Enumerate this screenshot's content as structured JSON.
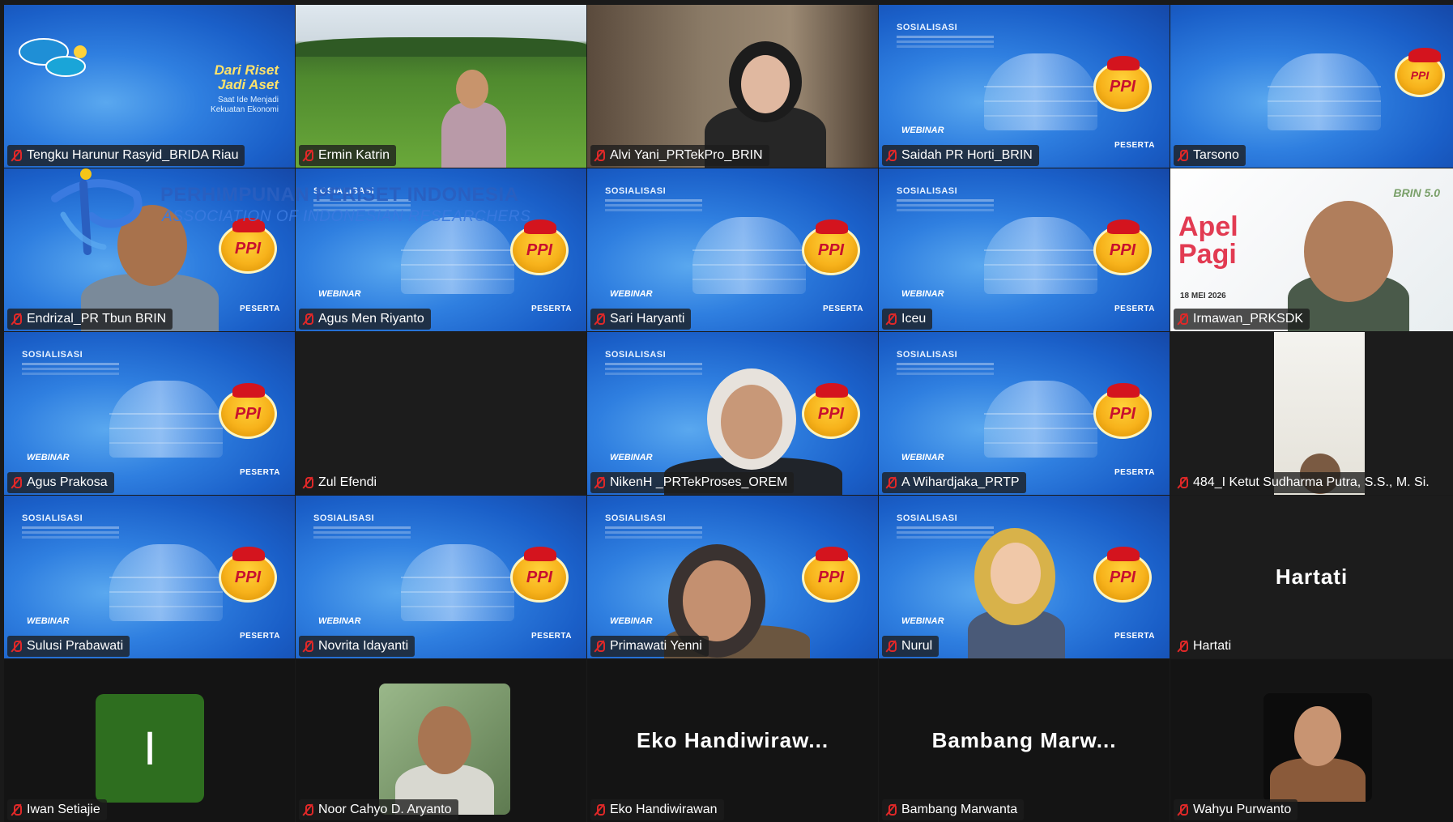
{
  "watermark": {
    "title": "PERHIMPUNAN PERISET INDONESIA",
    "subtitle": "ASSOCIATION OF INDONESIAN RESEARCHERS"
  },
  "slide": {
    "heading": "SOSIALISASI",
    "webinar": "WEBINAR",
    "peserta": "PESERTA",
    "badge": "PPI"
  },
  "campus_slide": {
    "title_line1": "Dari Riset",
    "title_line2": "Jadi Aset",
    "sub_line1": "Saat Ide Menjadi",
    "sub_line2": "Kekuatan Ekonomi"
  },
  "apel_slide": {
    "title_line1": "Apel",
    "title_line2": "Pagi",
    "date": "18 MEI 2026",
    "brand": "BRIN 5.0"
  },
  "participants": [
    {
      "name": "Tengku Harunur Rasyid_BRIDA Riau"
    },
    {
      "name": "Ermin Katrin"
    },
    {
      "name": "Alvi Yani_PRTekPro_BRIN"
    },
    {
      "name": "Saidah PR Horti_BRIN"
    },
    {
      "name": "Tarsono"
    },
    {
      "name": "Endrizal_PR Tbun BRIN"
    },
    {
      "name": "Agus Men Riyanto"
    },
    {
      "name": "Sari Haryanti"
    },
    {
      "name": "Iceu"
    },
    {
      "name": "Irmawan_PRKSDK"
    },
    {
      "name": "Agus Prakosa"
    },
    {
      "name": "Zul Efendi"
    },
    {
      "name": "NikenH _PRTekProses_OREM"
    },
    {
      "name": "A Wihardjaka_PRTP"
    },
    {
      "name": "484_I Ketut Sudharma Putra, S.S., M. Si."
    },
    {
      "name": "Sulusi Prabawati"
    },
    {
      "name": "Novrita Idayanti"
    },
    {
      "name": "Primawati Yenni"
    },
    {
      "name": "Nurul"
    },
    {
      "name": "Hartati",
      "display": "Hartati"
    },
    {
      "name": "Iwan Setiajie",
      "initial": "I"
    },
    {
      "name": "Noor Cahyo D. Aryanto"
    },
    {
      "name": "Eko Handiwirawan",
      "display": "Eko  Handiwiraw..."
    },
    {
      "name": "Bambang Marwanta",
      "display": "Bambang  Marw..."
    },
    {
      "name": "Wahyu Purwanto"
    }
  ]
}
